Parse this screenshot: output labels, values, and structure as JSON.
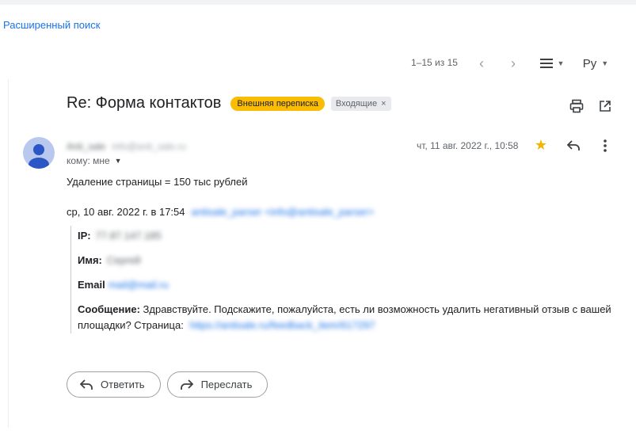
{
  "top": {
    "advanced_search": "Расширенный поиск"
  },
  "toolbar": {
    "pager": "1–15 из 15",
    "prev_icon": "chevron-left-icon",
    "next_icon": "chevron-right-icon",
    "density_icon": "density-icon",
    "language": "Ру"
  },
  "message": {
    "subject": "Re: Форма контактов",
    "labels": {
      "external": "Внешняя переписка",
      "inbox": "Входящие",
      "inbox_remove": "×"
    },
    "sender_name": "Anti_sale",
    "sender_email": "info@anti_sale.ru",
    "to": "кому: мне",
    "date": "чт, 11 авг. 2022 г., 10:58",
    "body_line1": "Удаление страницы = 150 тыс рублей",
    "quote_header": "ср, 10 авг. 2022 г. в 17:54",
    "quote_sender": "antisale_parser <info@antisale_parser>",
    "quote": {
      "ip_label": "IP:",
      "ip_value": "77.87.147.185",
      "name_label": "Имя:",
      "name_value": "Сергей",
      "email_label": "Email",
      "email_value": "mail@mail.ru",
      "message_label": "Сообщение:",
      "message_text": "Здравствуйте. Подскажите, пожалуйста, есть ли возможность удалить негативный отзыв с вашей площадки? Страница:",
      "page_link": "https://antisale.ru/feedback_item/617297"
    }
  },
  "actions": {
    "reply": "Ответить",
    "forward": "Переслать"
  },
  "colors": {
    "accent": "#1a73e8",
    "star": "#f4b400",
    "external_badge": "#fbbc04"
  }
}
